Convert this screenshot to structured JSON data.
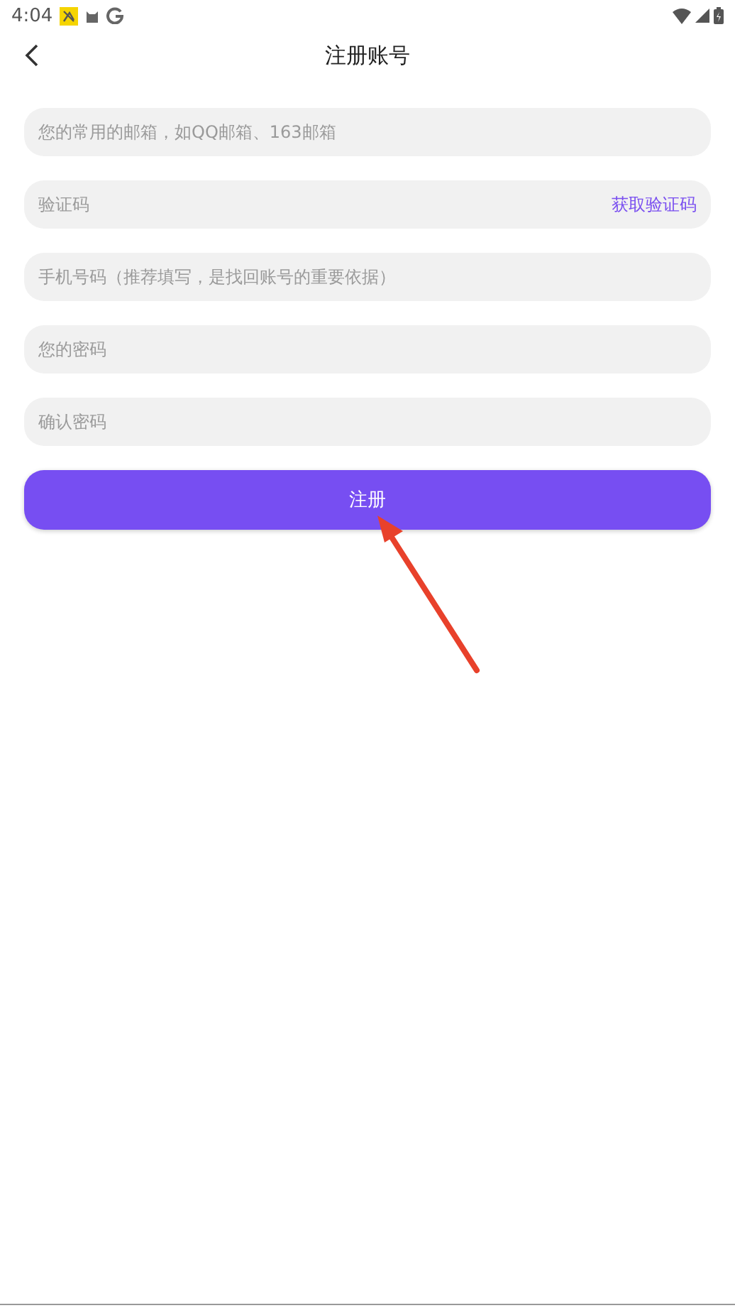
{
  "status_bar": {
    "time": "4:04"
  },
  "header": {
    "title": "注册账号"
  },
  "fields": [
    {
      "kind": "plain",
      "placeholder": "您的常用的邮箱，如QQ邮箱、163邮箱"
    },
    {
      "kind": "code",
      "placeholder": "验证码",
      "action": "获取验证码"
    },
    {
      "kind": "plain",
      "placeholder": "手机号码（推荐填写，是找回账号的重要依据）"
    },
    {
      "kind": "password",
      "placeholder": "您的密码"
    },
    {
      "kind": "password",
      "placeholder": "确认密码"
    }
  ],
  "submit_button": {
    "label": "注册"
  }
}
